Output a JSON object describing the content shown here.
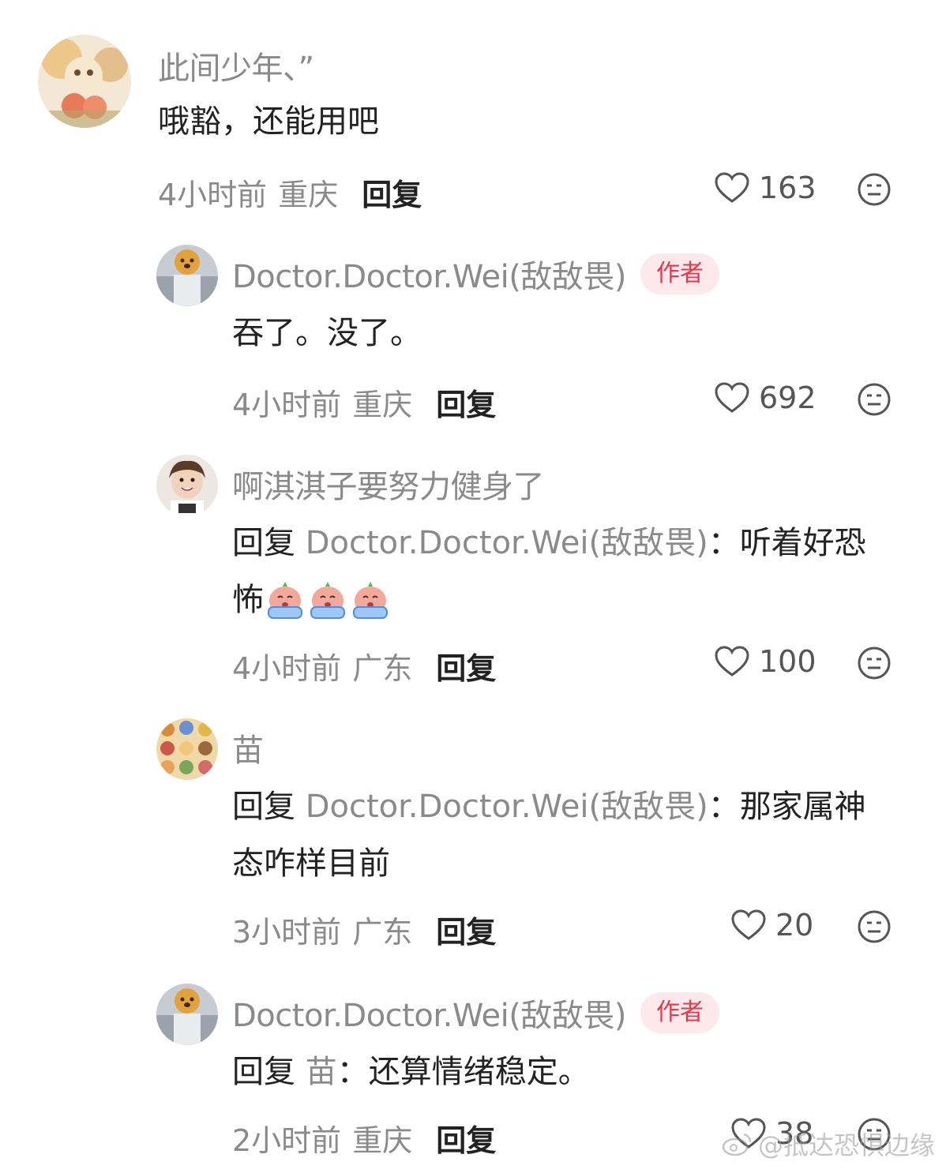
{
  "comments": [
    {
      "username": "此间少年、”",
      "text": "哦豁，还能用吧",
      "time": "4小时前",
      "location": "重庆",
      "reply_label": "回复",
      "likes": "163"
    },
    {
      "username": "Doctor.Doctor.Wei(敌敌畏)",
      "badge": "作者",
      "text": "吞了。没了。",
      "time": "4小时前",
      "location": "重庆",
      "reply_label": "回复",
      "likes": "692"
    },
    {
      "username": "啊淇淇子要努力健身了",
      "reply_prefix": "回复",
      "reply_to": "Doctor.Doctor.Wei(敌敌畏)",
      "reply_colon": "：",
      "text_line1": "听着好恐",
      "text_line2": "怖",
      "time": "4小时前",
      "location": "广东",
      "reply_label": "回复",
      "likes": "100"
    },
    {
      "username": "苗",
      "reply_prefix": "回复",
      "reply_to": "Doctor.Doctor.Wei(敌敌畏)",
      "reply_colon": "：",
      "text_line1": "那家属神",
      "text_line2": "态咋样目前",
      "time": "3小时前",
      "location": "广东",
      "reply_label": "回复",
      "likes": "20"
    },
    {
      "username": "Doctor.Doctor.Wei(敌敌畏)",
      "badge": "作者",
      "reply_prefix": "回复",
      "reply_to": "苗",
      "reply_colon": "：",
      "text": "还算情绪稳定。",
      "time": "2小时前",
      "location": "重庆",
      "reply_label": "回复",
      "likes": "38"
    }
  ],
  "watermark": "@抵达恐惧边缘",
  "colors": {
    "badge_bg": "#fbe9ec",
    "badge_text": "#e8364b",
    "muted": "#8a8a8a",
    "text": "#222222"
  }
}
